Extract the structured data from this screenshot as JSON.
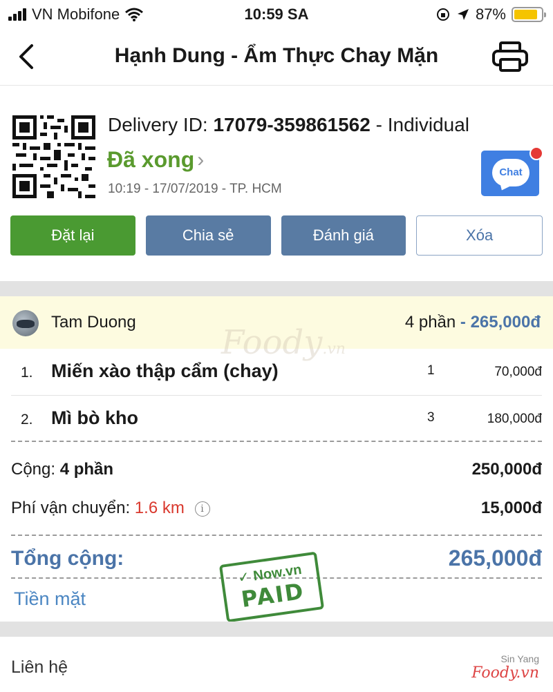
{
  "status_bar": {
    "carrier": "VN Mobifone",
    "time": "10:59 SA",
    "battery": "87%",
    "battery_level": 0.87
  },
  "nav": {
    "title": "Hạnh Dung - Ẩm Thực Chay Mặn"
  },
  "order": {
    "delivery_label": "Delivery ID:",
    "delivery_id": "17079-359861562",
    "delivery_type": "- Individual",
    "status": "Đã xong",
    "meta": "10:19 - 17/07/2019 - TP. HCM",
    "chat_label": "Chat"
  },
  "actions": {
    "reorder": "Đặt lại",
    "share": "Chia sẻ",
    "rate": "Đánh giá",
    "delete": "Xóa"
  },
  "user": {
    "name": "Tam Duong",
    "portions": "4 phần",
    "separator": "-",
    "amount": "265,000đ"
  },
  "watermark": {
    "brand": "Foody",
    "suffix": ".vn"
  },
  "items": [
    {
      "index": "1.",
      "name": "Miến xào thập cẩm (chay)",
      "qty": "1",
      "price": "70,000đ"
    },
    {
      "index": "2.",
      "name": "Mì bò kho",
      "qty": "3",
      "price": "180,000đ"
    }
  ],
  "summary": {
    "subtotal_label": "Cộng:",
    "subtotal_portions": "4 phần",
    "subtotal_value": "250,000đ",
    "shipping_label": "Phí vận chuyển:",
    "shipping_distance": "1.6 km",
    "shipping_info": "i",
    "shipping_value": "15,000đ",
    "total_label": "Tổng cộng:",
    "total_value": "265,000đ",
    "payment_method": "Tiền mặt"
  },
  "stamp": {
    "top": "Now.vn",
    "main": "PAID"
  },
  "footer": {
    "contact": "Liên hệ",
    "credit_small": "Sin Yang",
    "credit_brand": "Foody.vn"
  },
  "colors": {
    "green": "#4a9a32",
    "blue": "#597ba3",
    "accent_blue": "#4b74a8",
    "red": "#d9382d"
  }
}
